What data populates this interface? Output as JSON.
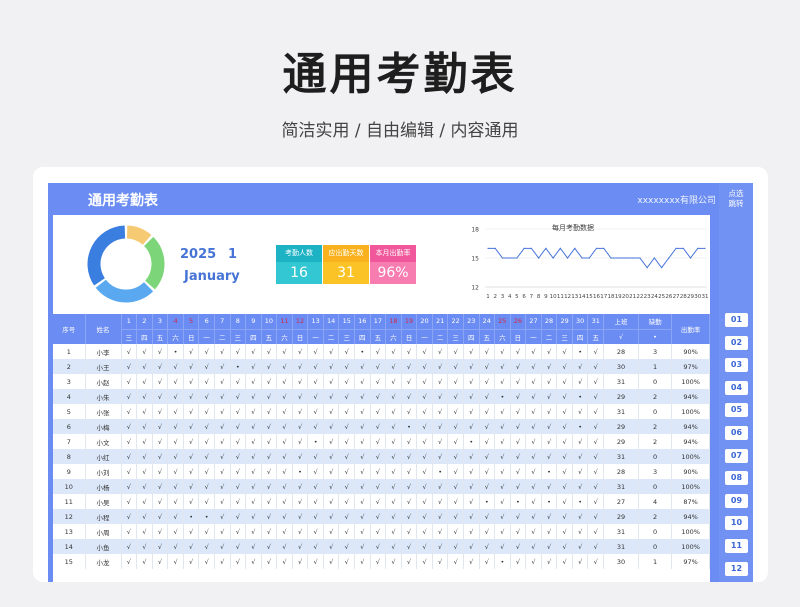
{
  "hero": {
    "title": "通用考勤表",
    "subtitle": "简洁实用 / 自由编辑 / 内容通用"
  },
  "sheet": {
    "title": "通用考勤表",
    "company": "xxxxxxxx有限公司",
    "year": "2025",
    "month_number": "1",
    "month_name": "January"
  },
  "jump": {
    "label_line1": "点选",
    "label_line2": "跳转",
    "buttons": [
      "01",
      "02",
      "03",
      "04",
      "05",
      "06",
      "07",
      "08",
      "09",
      "10",
      "11",
      "12"
    ]
  },
  "stats": [
    {
      "label": "考勤人数",
      "value": "16",
      "header_color": "#1db3c5",
      "value_color": "#33c6d3"
    },
    {
      "label": "应出勤天数",
      "value": "31",
      "header_color": "#f9b21e",
      "value_color": "#fcc327"
    },
    {
      "label": "本月出勤率",
      "value": "96%",
      "header_color": "#f0589b",
      "value_color": "#f77cb0"
    }
  ],
  "donut": {
    "segments": [
      {
        "value": 12,
        "color": "#f6ca73"
      },
      {
        "value": 25,
        "color": "#7cd679"
      },
      {
        "value": 28,
        "color": "#5aa9f0"
      },
      {
        "value": 35,
        "color": "#3a7fe0"
      }
    ]
  },
  "chart_data": {
    "type": "line",
    "title": "每月考勤数据",
    "x": [
      1,
      2,
      3,
      4,
      5,
      6,
      7,
      8,
      9,
      10,
      11,
      12,
      13,
      14,
      15,
      16,
      17,
      18,
      19,
      20,
      21,
      22,
      23,
      24,
      25,
      26,
      27,
      28,
      29,
      30,
      31
    ],
    "series": [
      {
        "values": [
          16,
          16,
          15,
          15,
          15,
          16,
          16,
          15,
          16,
          15,
          16,
          15,
          16,
          15,
          15,
          16,
          16,
          15,
          15,
          15,
          15,
          15,
          14,
          15,
          14,
          15,
          16,
          16,
          15,
          16,
          16
        ]
      }
    ],
    "ylim": [
      12,
      18
    ],
    "yticks": [
      12,
      15,
      18
    ],
    "color": "#4673d8"
  },
  "table": {
    "header_no": "序号",
    "header_name": "姓名",
    "header_work": "上班",
    "header_work_sub": "√",
    "header_absent": "缺勤",
    "header_absent_sub": "•",
    "header_rate": "出勤率",
    "days": [
      "1",
      "2",
      "3",
      "4",
      "5",
      "6",
      "7",
      "8",
      "9",
      "10",
      "11",
      "12",
      "13",
      "14",
      "15",
      "16",
      "17",
      "18",
      "19",
      "20",
      "21",
      "22",
      "23",
      "24",
      "25",
      "26",
      "27",
      "28",
      "29",
      "30",
      "31"
    ],
    "weekdays": [
      "三",
      "四",
      "五",
      "六",
      "日",
      "一",
      "二",
      "三",
      "四",
      "五",
      "六",
      "日",
      "一",
      "二",
      "三",
      "四",
      "五",
      "六",
      "日",
      "一",
      "二",
      "三",
      "四",
      "五",
      "六",
      "日",
      "一",
      "二",
      "三",
      "四",
      "五"
    ],
    "weekend_days": [
      4,
      5,
      11,
      12,
      18,
      19,
      25,
      26
    ],
    "rows": [
      {
        "no": "1",
        "name": "小李",
        "marks": "√√√•√√√√√√√√√√√•√√√√√√√√√√√√√•√",
        "work": "28",
        "absent": "3",
        "rate": "90%"
      },
      {
        "no": "2",
        "name": "小王",
        "marks": "√√√√√√√•√√√√√√√√√√√√√√√√√√√√√√√",
        "work": "30",
        "absent": "1",
        "rate": "97%"
      },
      {
        "no": "3",
        "name": "小赵",
        "marks": "√√√√√√√√√√√√√√√√√√√√√√√√√√√√√√√",
        "work": "31",
        "absent": "0",
        "rate": "100%"
      },
      {
        "no": "4",
        "name": "小朱",
        "marks": "√√√√√√√√√√√√√√√√√√√√√√√√•√√√√•√",
        "work": "29",
        "absent": "2",
        "rate": "94%"
      },
      {
        "no": "5",
        "name": "小张",
        "marks": "√√√√√√√√√√√√√√√√√√√√√√√√√√√√√√√",
        "work": "31",
        "absent": "0",
        "rate": "100%"
      },
      {
        "no": "6",
        "name": "小梅",
        "marks": "√√√√√√√√√√√√√√√√√√•√√√√√√√√√√•√",
        "work": "29",
        "absent": "2",
        "rate": "94%"
      },
      {
        "no": "7",
        "name": "小文",
        "marks": "√√√√√√√√√√√√•√√√√√√√√√•√√√√√√√√",
        "work": "29",
        "absent": "2",
        "rate": "94%"
      },
      {
        "no": "8",
        "name": "小红",
        "marks": "√√√√√√√√√√√√√√√√√√√√√√√√√√√√√√√",
        "work": "31",
        "absent": "0",
        "rate": "100%"
      },
      {
        "no": "9",
        "name": "小刘",
        "marks": "√√√√√√√√√√√•√√√√√√√√•√√√√√√•√√√",
        "work": "28",
        "absent": "3",
        "rate": "90%"
      },
      {
        "no": "10",
        "name": "小杨",
        "marks": "√√√√√√√√√√√√√√√√√√√√√√√√√√√√√√√",
        "work": "31",
        "absent": "0",
        "rate": "100%"
      },
      {
        "no": "11",
        "name": "小吴",
        "marks": "√√√√√√√√√√√√√√√√√√√√√√√•√•√•√•√",
        "work": "27",
        "absent": "4",
        "rate": "87%"
      },
      {
        "no": "12",
        "name": "小程",
        "marks": "√√√√••√√√√√√√√√√√√√√√√√√√√√√√√√",
        "work": "29",
        "absent": "2",
        "rate": "94%"
      },
      {
        "no": "13",
        "name": "小周",
        "marks": "√√√√√√√√√√√√√√√√√√√√√√√√√√√√√√√",
        "work": "31",
        "absent": "0",
        "rate": "100%"
      },
      {
        "no": "14",
        "name": "小鱼",
        "marks": "√√√√√√√√√√√√√√√√√√√√√√√√√√√√√√√",
        "work": "31",
        "absent": "0",
        "rate": "100%"
      },
      {
        "no": "15",
        "name": "小龙",
        "marks": "√√√√√√√√√√√√√√√√√√√√√√√√•√√√√√√",
        "work": "30",
        "absent": "1",
        "rate": "97%"
      }
    ]
  }
}
